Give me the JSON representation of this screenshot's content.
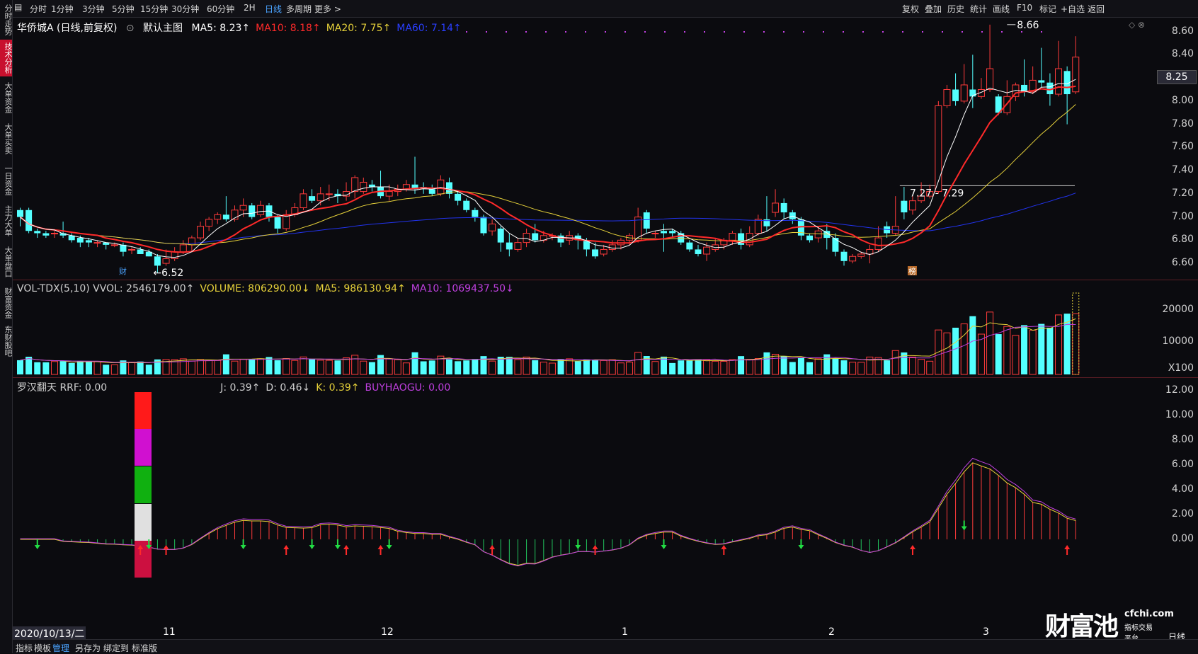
{
  "left_tabs": [
    {
      "label": "分时走势",
      "active": false
    },
    {
      "label": "技术分析",
      "active": true
    },
    {
      "label": "大单资金",
      "active": false
    },
    {
      "label": "大单买卖",
      "active": false
    },
    {
      "label": "一日资金",
      "active": false
    },
    {
      "label": "主力大单",
      "active": false
    },
    {
      "label": "大单盘口",
      "active": false
    },
    {
      "label": "财富资金",
      "active": false
    },
    {
      "label": "东财股吧",
      "active": false
    }
  ],
  "toolbar": {
    "periods": [
      "分时",
      "1分钟",
      "3分钟",
      "5分钟",
      "15分钟",
      "30分钟",
      "60分钟",
      "2H",
      "日线",
      "多周期",
      "更多 >"
    ],
    "active_period": "日线",
    "right_items": [
      "复权",
      "叠加",
      "历史",
      "统计",
      "画线",
      "F10",
      "标记",
      "+自选",
      "返回"
    ]
  },
  "main_pane": {
    "stock_name": "华侨城A (日线,前复权)",
    "indicator_label": "默认主图",
    "ma_labels": [
      {
        "text": "MA5: 8.23↑",
        "color": "#ffffff"
      },
      {
        "text": "MA10: 8.18↑",
        "color": "#ff2a2a"
      },
      {
        "text": "MA20: 7.75↑",
        "color": "#e6d13a"
      },
      {
        "text": "MA60: 7.14↑",
        "color": "#2a3fff"
      }
    ],
    "y_ticks": [
      "8.60",
      "8.40",
      "8.20",
      "8.00",
      "7.80",
      "7.60",
      "7.40",
      "7.20",
      "7.00",
      "6.80",
      "6.60"
    ],
    "current_price": "8.25",
    "high_label": "8.66",
    "low_label": "6.52",
    "range_label": "7.27 - 7.29",
    "marker_cai": "财",
    "marker_bang": "榜"
  },
  "vol_pane": {
    "labels": [
      {
        "text": "VOL-TDX(5,10) VVOL: 2546179.00↑",
        "color": "#cfcfcf"
      },
      {
        "text": "VOLUME: 806290.00↓",
        "color": "#e6d13a"
      },
      {
        "text": "MA5: 986130.94↑",
        "color": "#e6d13a"
      },
      {
        "text": "MA10: 1069437.50↓",
        "color": "#c040e0"
      }
    ],
    "y_ticks": [
      "20000",
      "10000",
      "X100"
    ]
  },
  "ind_pane": {
    "labels": [
      {
        "text": "罗汉翻天 RRF: 0.00",
        "color": "#cfcfcf"
      },
      {
        "text": "J: 0.39↑",
        "color": "#cfcfcf"
      },
      {
        "text": "D: 0.46↓",
        "color": "#cfcfcf"
      },
      {
        "text": "K: 0.39↑",
        "color": "#e6d13a"
      },
      {
        "text": "BUYHAOGU: 0.00",
        "color": "#c040e0"
      }
    ],
    "y_ticks": [
      "12.00",
      "10.00",
      "8.00",
      "6.00",
      "4.00",
      "2.00",
      "0.00"
    ]
  },
  "date_axis": {
    "labels": [
      "2020/10/13/二",
      "11",
      "12",
      "1",
      "2",
      "3"
    ],
    "right_label": "日线"
  },
  "bottom_bar": {
    "items": [
      "指标",
      "模板",
      "管理",
      "另存为",
      "绑定到",
      "标准版"
    ],
    "active": "管理"
  },
  "watermark": {
    "brand": "财富池",
    "site": "cfchi.com",
    "slogan": "指标交易平台"
  },
  "chart_data": {
    "type": "candlestick",
    "up_color": "#ff3b3b",
    "down_color": "#54ffff",
    "bars": [
      [
        7.06,
        7.0,
        7.08,
        6.92
      ],
      [
        7.06,
        6.88,
        7.08,
        6.86
      ],
      [
        6.88,
        6.86,
        6.9,
        6.82
      ],
      [
        6.86,
        6.84,
        6.88,
        6.82
      ],
      [
        6.86,
        6.86,
        6.88,
        6.82
      ],
      [
        6.86,
        6.84,
        6.96,
        6.82
      ],
      [
        6.84,
        6.8,
        6.86,
        6.78
      ],
      [
        6.82,
        6.78,
        6.84,
        6.74
      ],
      [
        6.8,
        6.78,
        6.82,
        6.74
      ],
      [
        6.78,
        6.78,
        6.8,
        6.74
      ],
      [
        6.78,
        6.76,
        6.78,
        6.72
      ],
      [
        6.76,
        6.76,
        6.78,
        6.74
      ],
      [
        6.76,
        6.7,
        6.78,
        6.66
      ],
      [
        6.72,
        6.72,
        6.74,
        6.68
      ],
      [
        6.72,
        6.68,
        6.74,
        6.68
      ],
      [
        6.7,
        6.66,
        6.72,
        6.66
      ],
      [
        6.66,
        6.58,
        6.68,
        6.52
      ],
      [
        6.6,
        6.64,
        6.72,
        6.58
      ],
      [
        6.64,
        6.7,
        6.74,
        6.62
      ],
      [
        6.7,
        6.76,
        6.8,
        6.68
      ],
      [
        6.76,
        6.82,
        6.84,
        6.7
      ],
      [
        6.82,
        6.92,
        6.96,
        6.8
      ],
      [
        6.92,
        6.98,
        7.0,
        6.88
      ],
      [
        6.98,
        7.02,
        7.04,
        6.94
      ],
      [
        7.02,
        6.98,
        7.18,
        6.96
      ],
      [
        6.98,
        7.06,
        7.1,
        6.96
      ],
      [
        7.06,
        7.1,
        7.16,
        7.0
      ],
      [
        7.1,
        7.0,
        7.12,
        6.98
      ],
      [
        7.02,
        7.1,
        7.14,
        7.0
      ],
      [
        7.1,
        7.0,
        7.12,
        6.96
      ],
      [
        7.0,
        6.9,
        7.02,
        6.86
      ],
      [
        6.9,
        7.02,
        7.06,
        6.88
      ],
      [
        7.02,
        7.08,
        7.12,
        7.0
      ],
      [
        7.08,
        7.2,
        7.24,
        7.06
      ],
      [
        7.18,
        7.14,
        7.24,
        7.12
      ],
      [
        7.14,
        7.2,
        7.26,
        7.1
      ],
      [
        7.2,
        7.2,
        7.28,
        7.14
      ],
      [
        7.2,
        7.18,
        7.24,
        7.12
      ],
      [
        7.18,
        7.22,
        7.3,
        7.14
      ],
      [
        7.22,
        7.34,
        7.36,
        7.16
      ],
      [
        7.22,
        7.3,
        7.34,
        7.2
      ],
      [
        7.28,
        7.26,
        7.32,
        7.22
      ],
      [
        7.26,
        7.18,
        7.4,
        7.16
      ],
      [
        7.18,
        7.22,
        7.28,
        7.14
      ],
      [
        7.22,
        7.24,
        7.28,
        7.18
      ],
      [
        7.24,
        7.28,
        7.32,
        7.22
      ],
      [
        7.28,
        7.24,
        7.52,
        7.2
      ],
      [
        7.26,
        7.24,
        7.3,
        7.2
      ],
      [
        7.24,
        7.2,
        7.28,
        7.18
      ],
      [
        7.2,
        7.32,
        7.36,
        7.18
      ],
      [
        7.3,
        7.2,
        7.34,
        7.16
      ],
      [
        7.2,
        7.14,
        7.22,
        7.1
      ],
      [
        7.14,
        7.06,
        7.16,
        7.04
      ],
      [
        7.06,
        7.0,
        7.08,
        6.96
      ],
      [
        7.0,
        6.86,
        7.02,
        6.84
      ],
      [
        6.88,
        6.94,
        6.98,
        6.84
      ],
      [
        6.9,
        6.78,
        6.92,
        6.7
      ],
      [
        6.78,
        6.72,
        6.86,
        6.66
      ],
      [
        6.72,
        6.78,
        6.82,
        6.7
      ],
      [
        6.78,
        6.86,
        6.9,
        6.74
      ],
      [
        6.86,
        6.8,
        6.94,
        6.78
      ],
      [
        6.8,
        6.84,
        6.88,
        6.78
      ],
      [
        6.84,
        6.84,
        6.86,
        6.8
      ],
      [
        6.84,
        6.78,
        6.86,
        6.74
      ],
      [
        6.8,
        6.84,
        6.88,
        6.76
      ],
      [
        6.84,
        6.8,
        6.86,
        6.72
      ],
      [
        6.8,
        6.72,
        6.82,
        6.66
      ],
      [
        6.72,
        6.66,
        6.78,
        6.64
      ],
      [
        6.68,
        6.72,
        6.76,
        6.66
      ],
      [
        6.72,
        6.76,
        6.8,
        6.7
      ],
      [
        6.76,
        6.8,
        6.82,
        6.72
      ],
      [
        6.8,
        6.84,
        6.86,
        6.76
      ],
      [
        6.8,
        7.0,
        7.08,
        6.78
      ],
      [
        7.04,
        6.9,
        7.06,
        6.86
      ],
      [
        6.86,
        6.86,
        6.88,
        6.82
      ],
      [
        6.88,
        6.86,
        6.94,
        6.7
      ],
      [
        6.88,
        6.86,
        6.9,
        6.82
      ],
      [
        6.86,
        6.78,
        6.88,
        6.76
      ],
      [
        6.78,
        6.72,
        6.8,
        6.7
      ],
      [
        6.72,
        6.68,
        6.76,
        6.66
      ],
      [
        6.68,
        6.74,
        6.78,
        6.62
      ],
      [
        6.72,
        6.76,
        6.82,
        6.7
      ],
      [
        6.76,
        6.8,
        6.82,
        6.72
      ],
      [
        6.8,
        6.86,
        6.88,
        6.76
      ],
      [
        6.86,
        6.76,
        6.9,
        6.72
      ],
      [
        6.76,
        6.86,
        6.92,
        6.74
      ],
      [
        6.86,
        6.98,
        7.02,
        6.84
      ],
      [
        6.98,
        6.92,
        7.18,
        6.88
      ],
      [
        7.04,
        7.12,
        7.24,
        7.0
      ],
      [
        7.12,
        7.04,
        7.16,
        6.98
      ],
      [
        7.04,
        6.98,
        7.06,
        6.94
      ],
      [
        6.98,
        6.84,
        7.0,
        6.8
      ],
      [
        6.84,
        6.8,
        6.86,
        6.78
      ],
      [
        6.82,
        6.88,
        6.92,
        6.78
      ],
      [
        6.88,
        6.82,
        6.94,
        6.72
      ],
      [
        6.82,
        6.7,
        6.86,
        6.66
      ],
      [
        6.7,
        6.62,
        6.72,
        6.58
      ],
      [
        6.62,
        6.66,
        6.68,
        6.6
      ],
      [
        6.66,
        6.68,
        6.7,
        6.64
      ],
      [
        6.68,
        6.72,
        6.76,
        6.6
      ],
      [
        6.72,
        6.82,
        6.92,
        6.7
      ],
      [
        6.92,
        6.86,
        6.96,
        6.82
      ],
      [
        6.86,
        6.92,
        7.18,
        6.84
      ],
      [
        7.14,
        7.04,
        7.26,
        6.98
      ],
      [
        7.06,
        7.14,
        7.18,
        7.02
      ],
      [
        7.14,
        7.18,
        7.3,
        7.12
      ],
      [
        7.18,
        7.22,
        7.28,
        7.16
      ],
      [
        7.22,
        7.96,
        8.0,
        7.2
      ],
      [
        7.96,
        8.1,
        8.14,
        7.94
      ],
      [
        8.1,
        8.0,
        8.24,
        7.96
      ],
      [
        8.0,
        8.14,
        8.32,
        7.98
      ],
      [
        8.1,
        8.04,
        8.4,
        7.94
      ],
      [
        8.04,
        8.1,
        8.2,
        8.02
      ],
      [
        8.1,
        8.28,
        8.66,
        8.08
      ],
      [
        8.04,
        7.9,
        8.06,
        7.88
      ],
      [
        7.9,
        8.04,
        8.18,
        7.88
      ],
      [
        8.04,
        8.14,
        8.16,
        8.0
      ],
      [
        8.14,
        8.08,
        8.36,
        8.04
      ],
      [
        8.08,
        8.18,
        8.3,
        8.06
      ],
      [
        8.18,
        8.16,
        8.46,
        8.12
      ],
      [
        8.16,
        8.06,
        8.24,
        7.96
      ],
      [
        8.06,
        8.28,
        8.52,
        8.04
      ],
      [
        8.26,
        8.06,
        8.3,
        7.8
      ],
      [
        8.08,
        8.38,
        8.56,
        8.06
      ]
    ],
    "volume_y_max": 25000
  }
}
